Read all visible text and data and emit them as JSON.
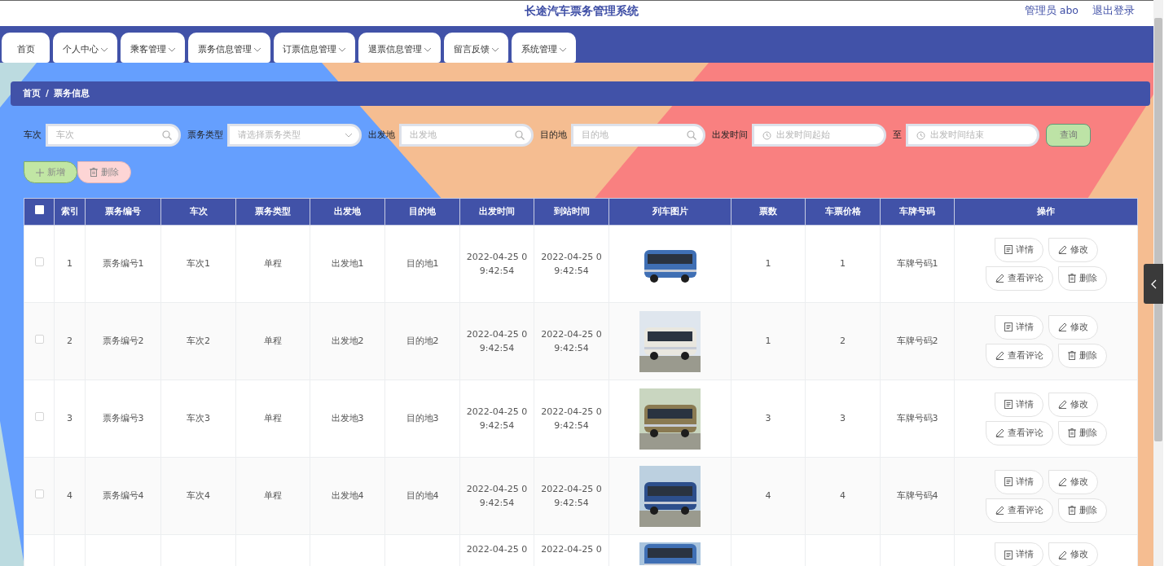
{
  "header": {
    "title": "长途汽车票务管理系统",
    "user": "管理员 abo",
    "logout": "退出登录"
  },
  "nav": [
    {
      "label": "首页",
      "dropdown": false
    },
    {
      "label": "个人中心",
      "dropdown": true
    },
    {
      "label": "乘客管理",
      "dropdown": true
    },
    {
      "label": "票务信息管理",
      "dropdown": true
    },
    {
      "label": "订票信息管理",
      "dropdown": true
    },
    {
      "label": "退票信息管理",
      "dropdown": true
    },
    {
      "label": "留言反馈",
      "dropdown": true
    },
    {
      "label": "系统管理",
      "dropdown": true
    }
  ],
  "breadcrumb": {
    "separator": "/",
    "items": [
      "首页",
      "票务信息"
    ]
  },
  "filters": [
    {
      "label": "车次",
      "placeholder": "车次",
      "kind": "search"
    },
    {
      "label": "票务类型",
      "placeholder": "请选择票务类型",
      "kind": "select"
    },
    {
      "label": "出发地",
      "placeholder": "出发地",
      "kind": "search"
    },
    {
      "label": "目的地",
      "placeholder": "目的地",
      "kind": "search"
    },
    {
      "label": "出发时间",
      "placeholder": "出发时间起始",
      "kind": "date"
    },
    {
      "label": "至",
      "placeholder": "出发时间结束",
      "kind": "date"
    }
  ],
  "search_button": "查询",
  "actions": [
    {
      "label": "新增",
      "kind": "add"
    },
    {
      "label": "删除",
      "kind": "delete"
    }
  ],
  "table": {
    "header_checked": false,
    "columns": [
      "索引",
      "票务编号",
      "车次",
      "票务类型",
      "出发地",
      "目的地",
      "出发时间",
      "到站时间",
      "列车图片",
      "票数",
      "车票价格",
      "车牌号码",
      "操作"
    ],
    "rows": [
      {
        "checked": false,
        "index": "1",
        "code": "票务编号1",
        "train": "车次1",
        "type": "单程",
        "from": "出发地1",
        "to": "目的地1",
        "depart": "2022-04-25 09:42:54",
        "arrive": "2022-04-25 09:42:54",
        "picture": {
          "kind": "picture"
        },
        "count": "1",
        "price": "1",
        "plate": "车牌号码1",
        "buttons": [
          {
            "label": "详情",
            "kind": "detail"
          },
          {
            "label": "修改",
            "kind": "edit"
          },
          {
            "label": "查看评论",
            "kind": "edit"
          },
          {
            "label": "删除",
            "kind": "delete"
          }
        ]
      },
      {
        "checked": false,
        "index": "2",
        "code": "票务编号2",
        "train": "车次2",
        "type": "单程",
        "from": "出发地2",
        "to": "目的地2",
        "depart": "2022-04-25 09:42:54",
        "arrive": "2022-04-25 09:42:54",
        "picture": {
          "kind": "picture"
        },
        "count": "1",
        "price": "2",
        "plate": "车牌号码2",
        "buttons": [
          {
            "label": "详情",
            "kind": "detail"
          },
          {
            "label": "修改",
            "kind": "edit"
          },
          {
            "label": "查看评论",
            "kind": "edit"
          },
          {
            "label": "删除",
            "kind": "delete"
          }
        ]
      },
      {
        "checked": false,
        "index": "3",
        "code": "票务编号3",
        "train": "车次3",
        "type": "单程",
        "from": "出发地3",
        "to": "目的地3",
        "depart": "2022-04-25 09:42:54",
        "arrive": "2022-04-25 09:42:54",
        "picture": {
          "kind": "picture"
        },
        "count": "3",
        "price": "3",
        "plate": "车牌号码3",
        "buttons": [
          {
            "label": "详情",
            "kind": "detail"
          },
          {
            "label": "修改",
            "kind": "edit"
          },
          {
            "label": "查看评论",
            "kind": "edit"
          },
          {
            "label": "删除",
            "kind": "delete"
          }
        ]
      },
      {
        "checked": false,
        "index": "4",
        "code": "票务编号4",
        "train": "车次4",
        "type": "单程",
        "from": "出发地4",
        "to": "目的地4",
        "depart": "2022-04-25 09:42:54",
        "arrive": "2022-04-25 09:42:54",
        "picture": {
          "kind": "picture"
        },
        "count": "4",
        "price": "4",
        "plate": "车牌号码4",
        "buttons": [
          {
            "label": "详情",
            "kind": "detail"
          },
          {
            "label": "修改",
            "kind": "edit"
          },
          {
            "label": "查看评论",
            "kind": "edit"
          },
          {
            "label": "删除",
            "kind": "delete"
          }
        ]
      },
      {
        "depart": "2022-04-25 0",
        "arrive": "2022-04-25 0",
        "picture": {
          "kind": "picture"
        },
        "buttons": [
          {
            "label": "详情",
            "kind": "detail"
          },
          {
            "label": "修改",
            "kind": "edit"
          }
        ]
      }
    ]
  }
}
